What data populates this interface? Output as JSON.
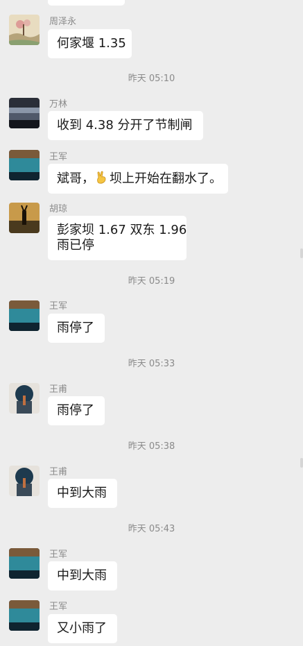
{
  "messages": [
    {
      "sender": "周泽永",
      "lines": [
        "何家堰 1.35"
      ],
      "avatar": "painting-avatar"
    },
    {
      "timestamp": "昨天 05:10"
    },
    {
      "sender": "万林",
      "lines": [
        "收到  4.38 分开了节制闸"
      ],
      "avatar": "night-lake-avatar"
    },
    {
      "sender": "王军",
      "lines": [
        "斌哥，",
        "坝上开始在翻水了。"
      ],
      "emoji": "victory-hand-emoji",
      "avatar": "lake-avatar"
    },
    {
      "sender": "胡琼",
      "lines": [
        "彭家坝 1.67 双东 1.96",
        "雨已停"
      ],
      "avatar": "sunset-person-avatar"
    },
    {
      "timestamp": "昨天 05:19"
    },
    {
      "sender": "王军",
      "lines": [
        "雨停了"
      ],
      "avatar": "lake-avatar"
    },
    {
      "timestamp": "昨天 05:33"
    },
    {
      "sender": "王甫",
      "lines": [
        "雨停了"
      ],
      "avatar": "silhouette-avatar"
    },
    {
      "timestamp": "昨天 05:38"
    },
    {
      "sender": "王甫",
      "lines": [
        "中到大雨"
      ],
      "avatar": "silhouette-avatar"
    },
    {
      "timestamp": "昨天 05:43"
    },
    {
      "sender": "王军",
      "lines": [
        "中到大雨"
      ],
      "avatar": "lake-avatar"
    },
    {
      "sender": "王军",
      "lines": [
        "又小雨了"
      ],
      "avatar": "lake-avatar"
    }
  ]
}
